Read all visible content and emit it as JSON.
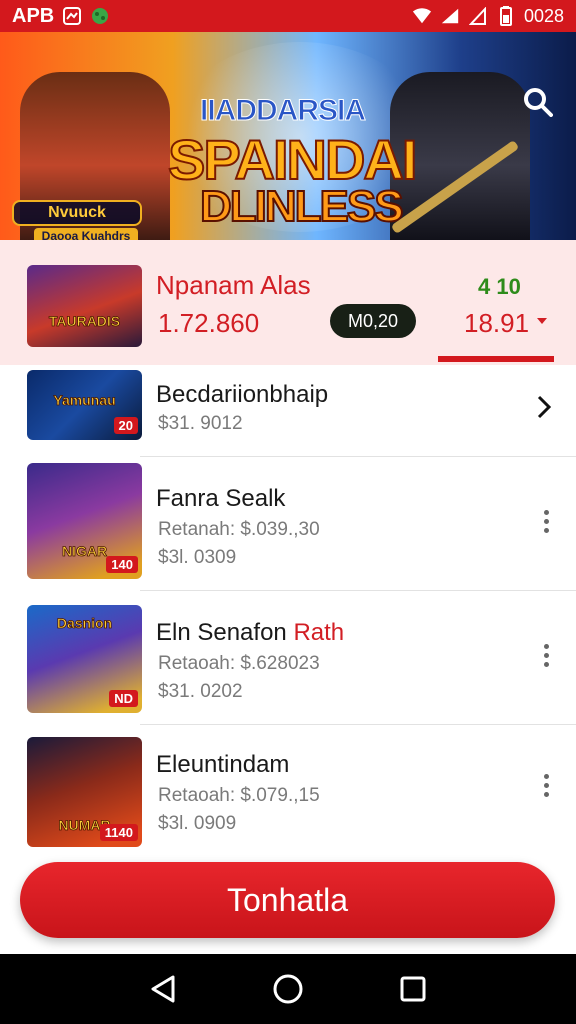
{
  "status_bar": {
    "app_label": "APB",
    "time": "0028",
    "bg_color": "#d3181d"
  },
  "banner": {
    "title_line1": "IIADDARSIA",
    "title_line2": "SPAINDAI",
    "title_line3": "DLINLESS",
    "badge_title": "Nvuuck",
    "badge_sub": "Daooa Kuahdrs",
    "search_icon": "search-icon"
  },
  "featured": {
    "name": "Npanam Alas",
    "price": "1.72.860",
    "pill": "M0,20",
    "change": "4 10",
    "change_value": "18.91",
    "thumb_text": "TAURADIS",
    "bg_color": "#fde8e8"
  },
  "list": {
    "items": [
      {
        "title": "Becdariionbhaip",
        "title_accent": "",
        "line1": "",
        "line2": "$31. 9012",
        "tag": "20",
        "thumb_text": "Yamunau",
        "action": "chevron"
      },
      {
        "title": "Fanra Sealk",
        "title_accent": "",
        "line1": "Retanah: $.039.,30",
        "line2": "$3l. 0309",
        "tag": "140",
        "thumb_text": "NIGAR",
        "action": "more"
      },
      {
        "title": "Eln Senafon ",
        "title_accent": "Rath",
        "line1": "Retaoah: $.628023",
        "line2": "$31. 0202",
        "tag": "ND",
        "thumb_text": "Dasnion",
        "action": "more"
      },
      {
        "title": "Eleuntindam",
        "title_accent": "",
        "line1": "Retaoah: $.079.,15",
        "line2": "$3l. 0909",
        "tag": "1140",
        "thumb_text": "NUMAR",
        "action": "more"
      }
    ]
  },
  "cta": {
    "label": "Tonhatla",
    "color": "#d3181d"
  },
  "nav": {
    "back_icon": "back-triangle-icon",
    "home_icon": "home-circle-icon",
    "recents_icon": "recents-square-icon"
  }
}
